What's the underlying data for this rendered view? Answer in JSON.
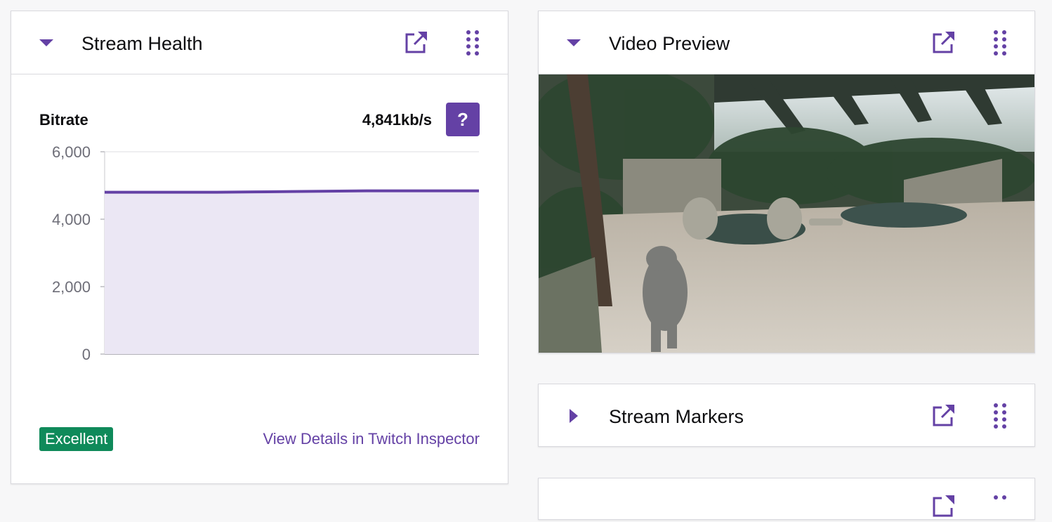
{
  "stream_health": {
    "title": "Stream Health",
    "bitrate_label": "Bitrate",
    "bitrate_value": "4,841kb/s",
    "help_label": "?",
    "status_badge": "Excellent",
    "details_link": "View Details in Twitch Inspector"
  },
  "chart_data": {
    "type": "area",
    "title": "",
    "xlabel": "",
    "ylabel": "",
    "ylim": [
      0,
      6000
    ],
    "yticks": [
      0,
      2000,
      4000,
      6000
    ],
    "ytick_labels": [
      "0",
      "2,000",
      "4,000",
      "6,000"
    ],
    "x": [
      0,
      1,
      2,
      3,
      4,
      5,
      6,
      7,
      8,
      9,
      10
    ],
    "values": [
      4800,
      4800,
      4800,
      4800,
      4810,
      4820,
      4830,
      4840,
      4841,
      4841,
      4841
    ],
    "grid": true,
    "line_color": "#6441a5",
    "fill_color": "#ebe7f4"
  },
  "video_preview": {
    "title": "Video Preview"
  },
  "stream_markers": {
    "title": "Stream Markers"
  },
  "colors": {
    "accent": "#6441a5",
    "success": "#0f8a5a"
  },
  "icons": {
    "collapse": "caret-down-icon",
    "expand": "caret-right-icon",
    "popout": "popout-icon",
    "drag": "drag-handle-icon"
  }
}
